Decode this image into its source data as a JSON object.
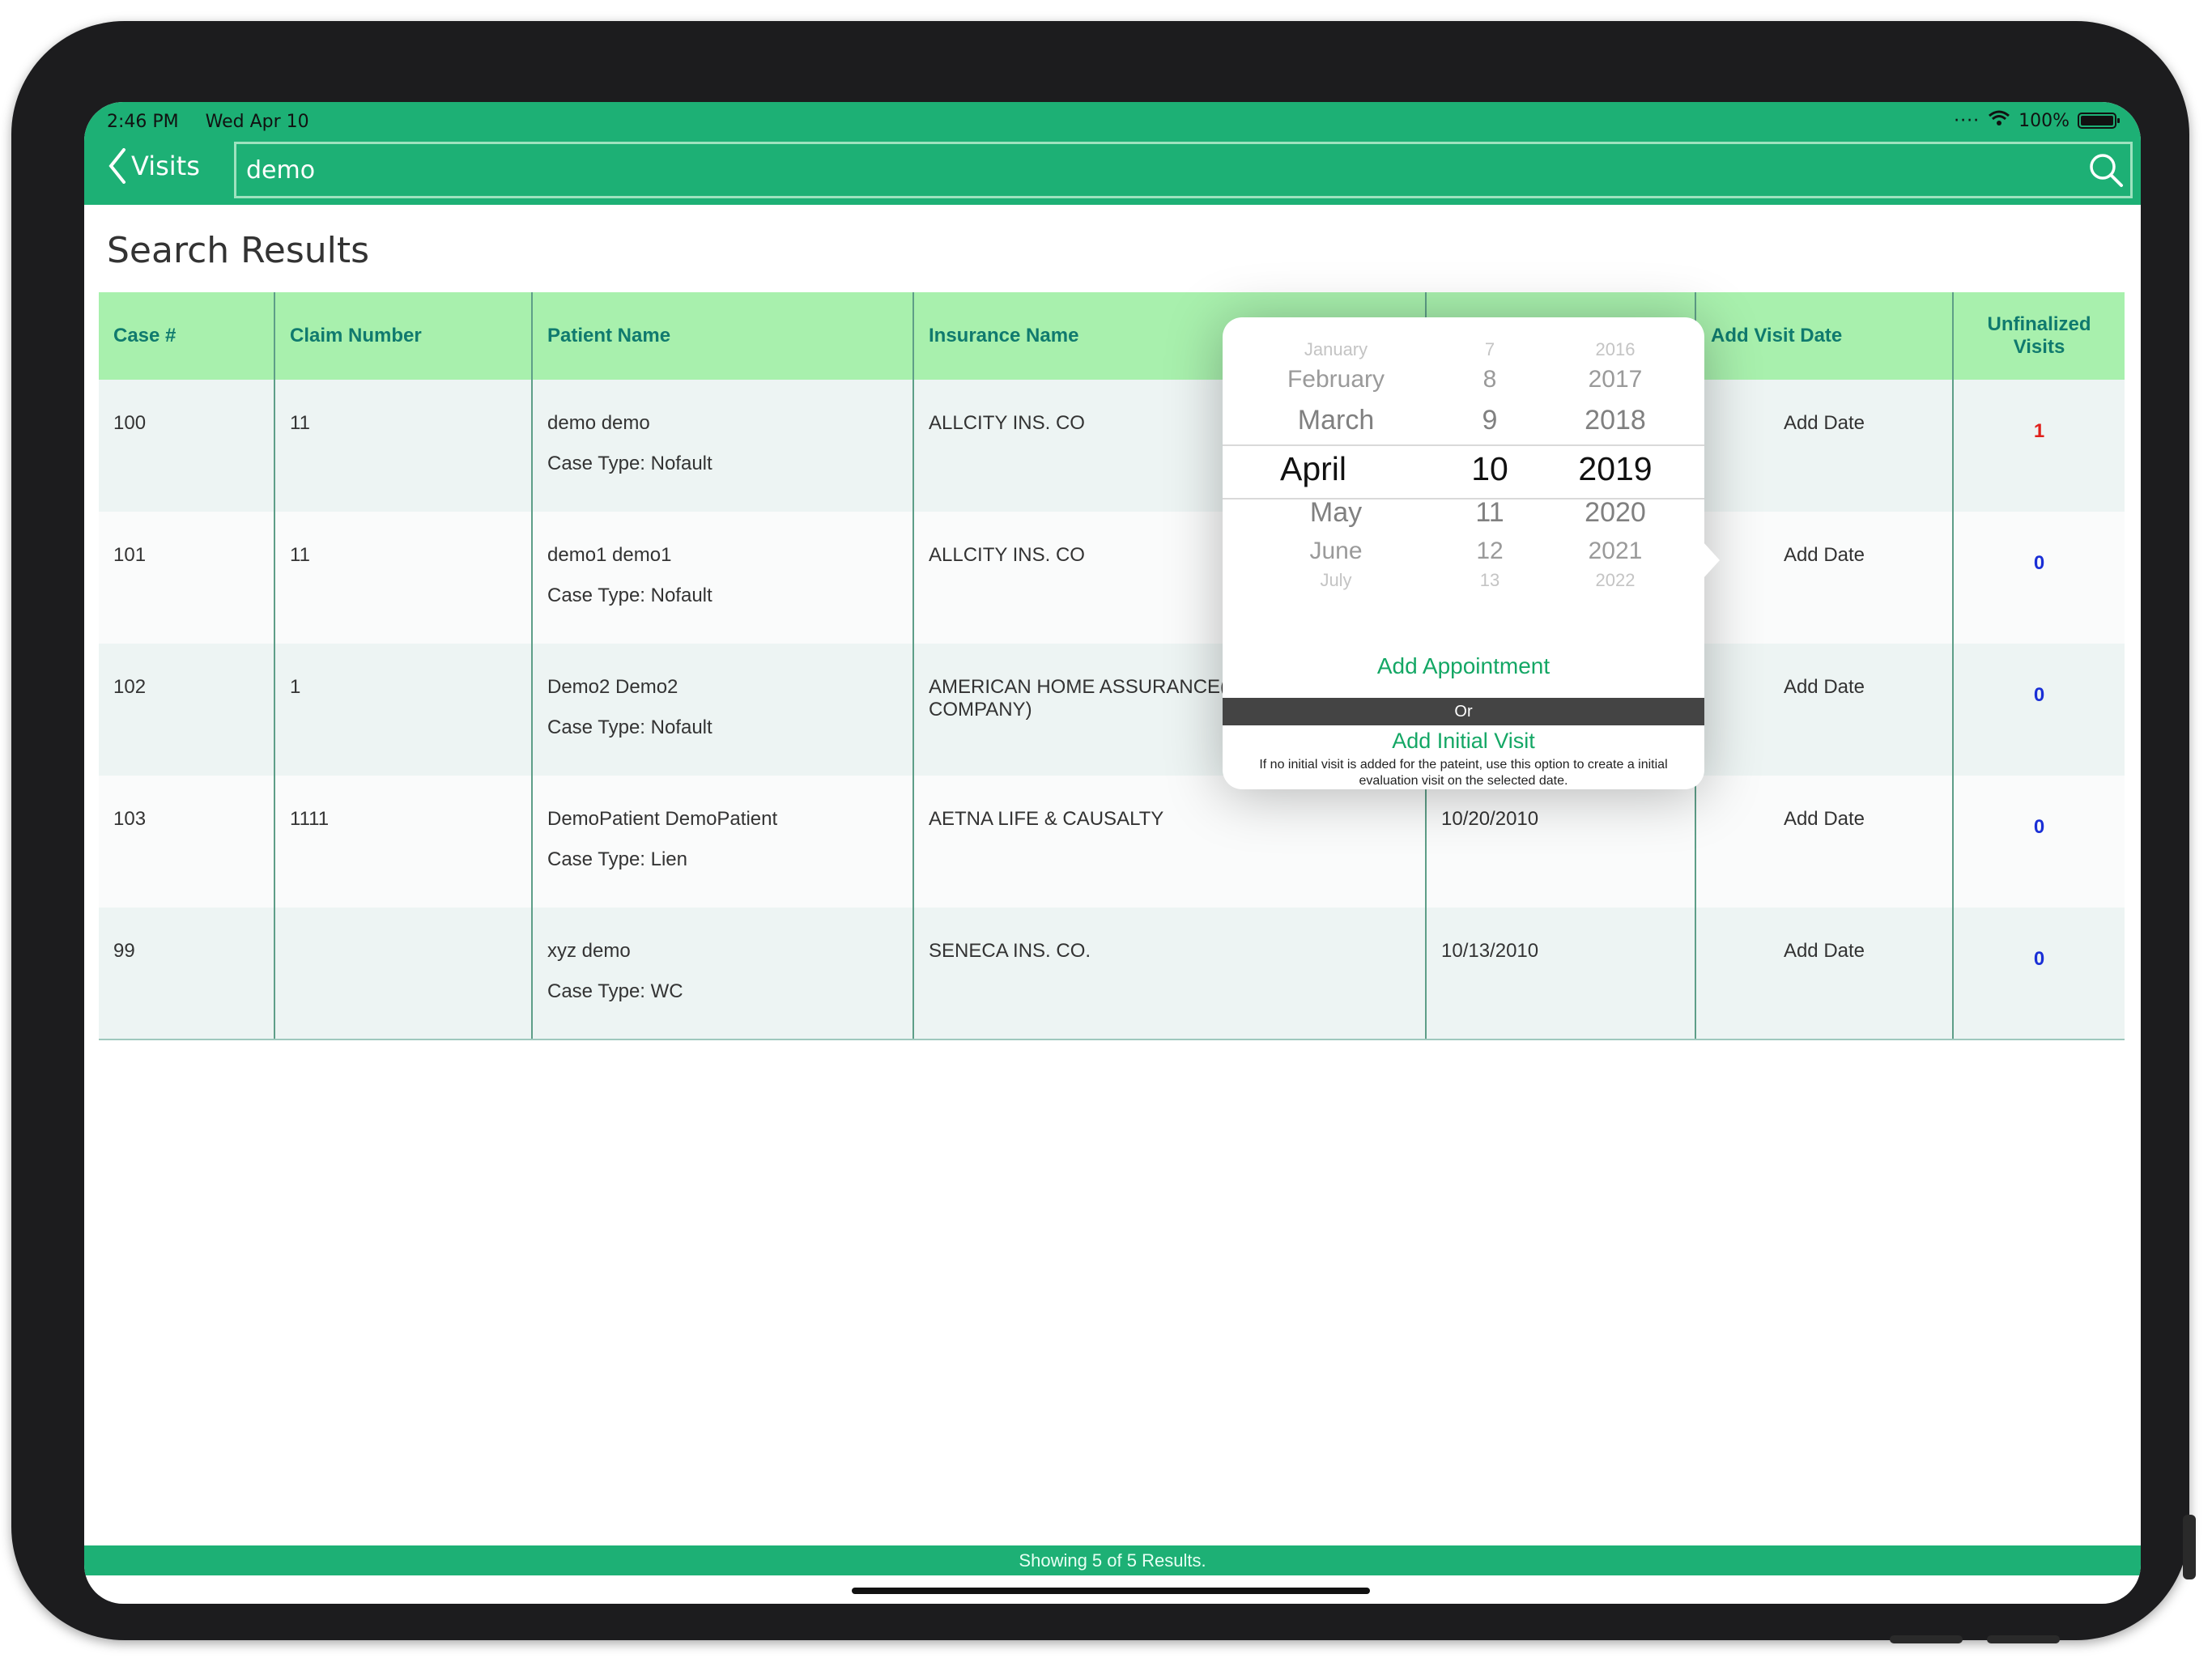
{
  "status_bar": {
    "time": "2:46 PM",
    "date": "Wed Apr 10",
    "battery": "100%"
  },
  "nav": {
    "back_label": "Visits",
    "search_value": "demo",
    "search_icon": "magnifier"
  },
  "page_title": "Search Results",
  "table": {
    "columns": [
      "Case #",
      "Claim Number",
      "Patient Name",
      "Insurance Name",
      "",
      "Add Visit Date",
      "Unfinalized Visits"
    ],
    "rows": [
      {
        "case": "100",
        "claim": "11",
        "patient": "demo demo",
        "case_type": "Case Type: Nofault",
        "insurance": "ALLCITY INS. CO",
        "date": "",
        "add_date": "Add Date",
        "unfinalized": "1"
      },
      {
        "case": "101",
        "claim": "11",
        "patient": "demo1 demo1",
        "case_type": "Case Type: Nofault",
        "insurance": "ALLCITY INS. CO",
        "date": "",
        "add_date": "Add Date",
        "unfinalized": "0"
      },
      {
        "case": "102",
        "claim": "1",
        "patient": "Demo2 Demo2",
        "case_type": "Case Type: Nofault",
        "insurance": "AMERICAN HOME ASSURANCE(A INSURANCE COMPANY)",
        "date": "",
        "add_date": "Add Date",
        "unfinalized": "0"
      },
      {
        "case": "103",
        "claim": "1111",
        "patient": "DemoPatient DemoPatient",
        "case_type": "Case Type: Lien",
        "insurance": "AETNA LIFE & CAUSALTY",
        "date": "10/20/2010",
        "add_date": "Add Date",
        "unfinalized": "0"
      },
      {
        "case": "99",
        "claim": "",
        "patient": "xyz demo",
        "case_type": "Case Type: WC",
        "insurance": "SENECA INS. CO.",
        "date": "10/13/2010",
        "add_date": "Add Date",
        "unfinalized": "0"
      }
    ]
  },
  "popover": {
    "months": [
      "January",
      "February",
      "March",
      "April",
      "May",
      "June",
      "July"
    ],
    "days": [
      "7",
      "8",
      "9",
      "10",
      "11",
      "12",
      "13"
    ],
    "years": [
      "2016",
      "2017",
      "2018",
      "2019",
      "2020",
      "2021",
      "2022"
    ],
    "selected": {
      "month": "April",
      "day": "10",
      "year": "2019"
    },
    "add_appointment": "Add Appointment",
    "or_label": "Or",
    "add_initial_visit": "Add Initial Visit",
    "initial_note": "If no initial visit is added for the pateint, use this option to create a initial evaluation visit on the selected date."
  },
  "footer": {
    "text": "Showing 5 of 5 Results."
  },
  "colors": {
    "header_green": "#1db075",
    "table_header": "#a8f0ad",
    "header_text": "#107a6e",
    "link_blue": "#2f6fd6",
    "unfinalized_nonzero": "#e0201b",
    "unfinalized_zero": "#1a2fd6",
    "action_green": "#14a765"
  }
}
